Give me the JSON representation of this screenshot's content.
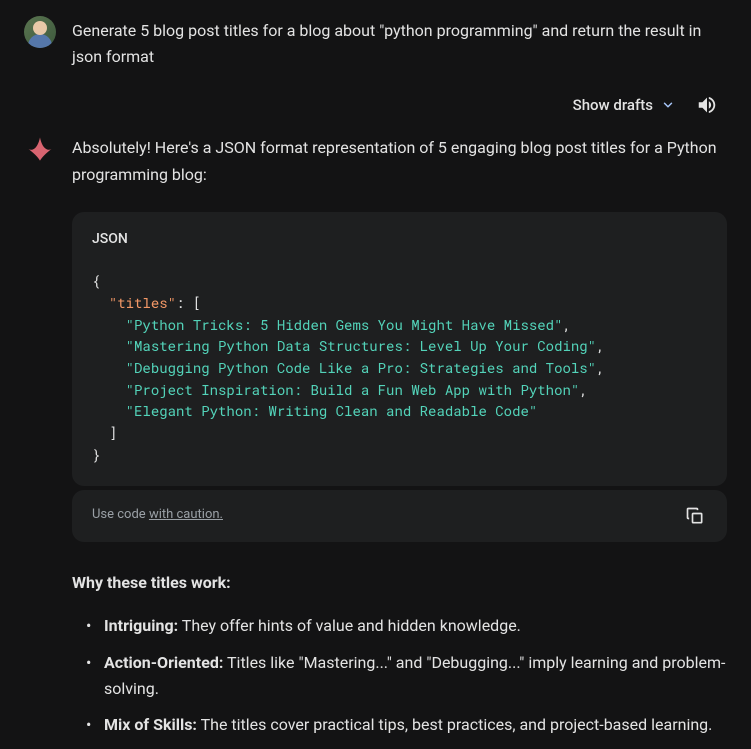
{
  "user": {
    "prompt": "Generate 5 blog post titles for a blog about \"python programming\" and return the result in json format"
  },
  "toolbar": {
    "show_drafts_label": "Show drafts"
  },
  "response": {
    "intro": "Absolutely! Here's a JSON format representation of 5 engaging blog post titles for a Python programming blog:",
    "code": {
      "language": "JSON",
      "key": "\"titles\"",
      "strings": [
        "\"Python Tricks: 5 Hidden Gems You Might Have Missed\"",
        "\"Mastering Python Data Structures: Level Up Your Coding\"",
        "\"Debugging Python Code Like a Pro: Strategies and Tools\"",
        "\"Project Inspiration: Build a Fun Web App with Python\"",
        "\"Elegant Python: Writing Clean and Readable Code\""
      ]
    },
    "caution": {
      "prefix": "Use code ",
      "link": "with caution."
    },
    "explanation": {
      "heading": "Why these titles work:",
      "bullets": [
        {
          "label": "Intriguing:",
          "text": " They offer hints of value and hidden knowledge."
        },
        {
          "label": "Action-Oriented:",
          "text": " Titles like \"Mastering...\" and \"Debugging...\" imply learning and problem-solving."
        },
        {
          "label": "Mix of Skills:",
          "text": " The titles cover practical tips, best practices, and project-based learning."
        }
      ]
    }
  }
}
